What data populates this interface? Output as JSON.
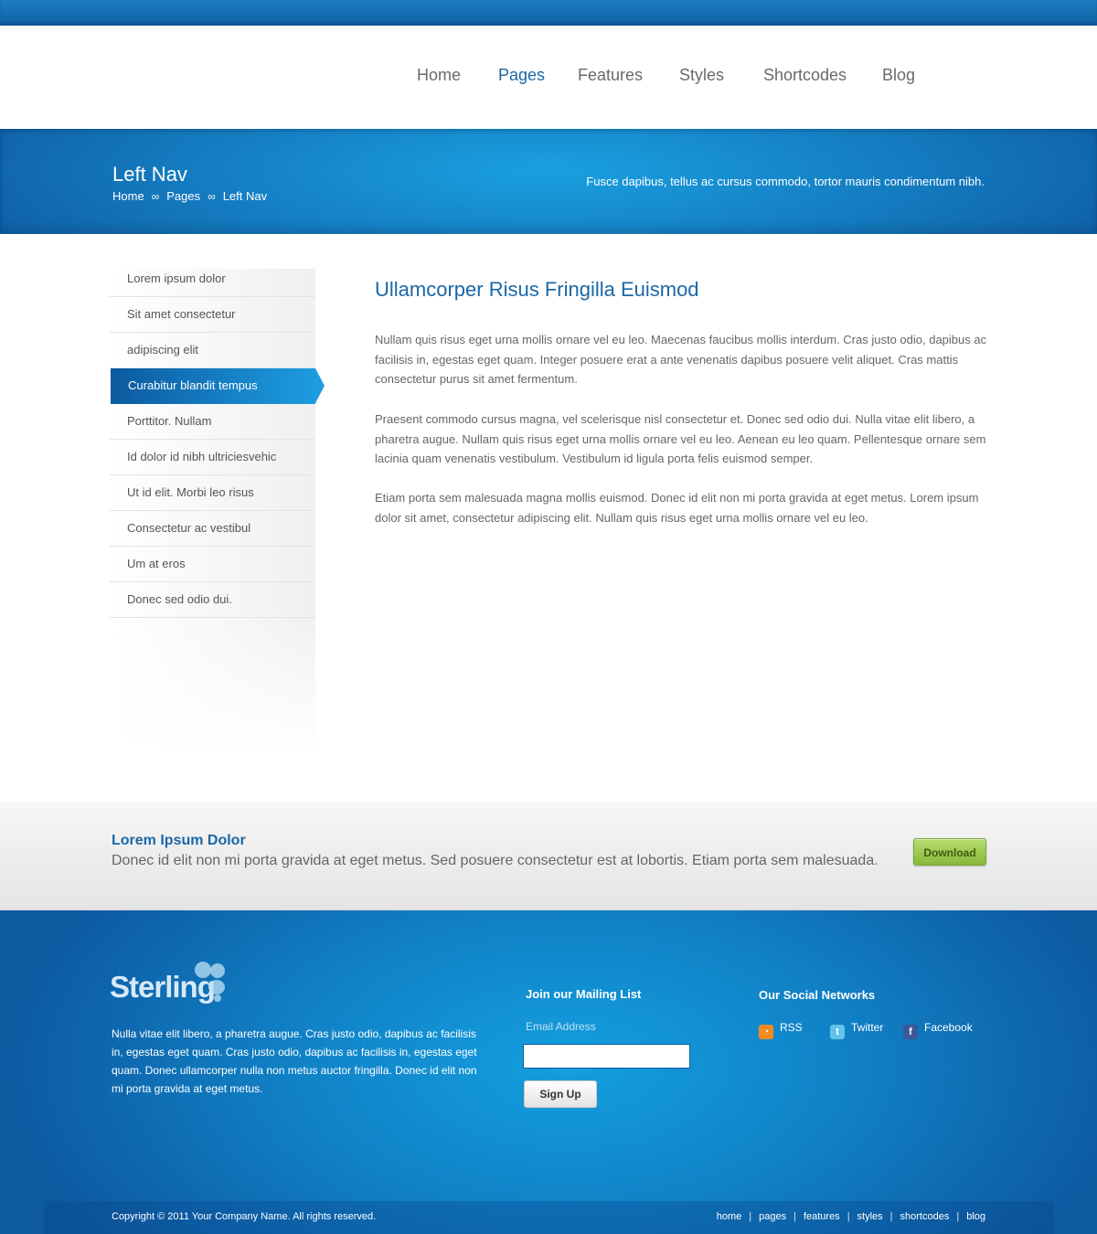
{
  "nav": {
    "items": [
      {
        "label": "Home"
      },
      {
        "label": "Pages"
      },
      {
        "label": "Features"
      },
      {
        "label": "Styles"
      },
      {
        "label": "Shortcodes"
      },
      {
        "label": "Blog"
      }
    ],
    "active": "Pages"
  },
  "banner": {
    "title": "Left Nav",
    "breadcrumb": [
      "Home",
      "Pages",
      "Left Nav"
    ],
    "separator": "∞",
    "tagline": "Fusce dapibus, tellus ac cursus commodo, tortor mauris condimentum nibh."
  },
  "sidebar": {
    "items": [
      {
        "label": "Lorem ipsum dolor"
      },
      {
        "label": "Sit amet consectetur"
      },
      {
        "label": "adipiscing elit"
      },
      {
        "label": "Curabitur blandit tempus"
      },
      {
        "label": "Porttitor. Nullam"
      },
      {
        "label": "Id dolor id nibh ultriciesvehic"
      },
      {
        "label": "Ut id elit. Morbi leo risus"
      },
      {
        "label": "Consectetur ac vestibul"
      },
      {
        "label": "Um at eros"
      },
      {
        "label": "Donec sed odio dui."
      }
    ],
    "active": "Curabitur blandit tempus"
  },
  "main": {
    "heading": "Ullamcorper Risus Fringilla Euismod",
    "paragraphs": [
      "Nullam quis risus eget urna mollis ornare vel eu leo. Maecenas faucibus mollis interdum. Cras justo odio, dapibus ac facilisis in, egestas eget quam. Integer posuere erat a ante venenatis dapibus posuere velit aliquet. Cras mattis consectetur purus sit amet fermentum.",
      "Praesent commodo cursus magna, vel scelerisque nisl consectetur et. Donec sed odio dui. Nulla vitae elit libero, a pharetra augue. Nullam quis risus eget urna mollis ornare vel eu leo. Aenean eu leo quam. Pellentesque ornare sem lacinia quam venenatis vestibulum. Vestibulum id ligula porta felis euismod semper.",
      "Etiam porta sem malesuada magna mollis euismod. Donec id elit non mi porta gravida at eget metus. Lorem ipsum dolor sit amet, consectetur adipiscing elit. Nullam quis risus eget urna mollis ornare vel eu leo."
    ]
  },
  "cta": {
    "heading": "Lorem Ipsum Dolor",
    "text": "Donec id elit non mi porta gravida at eget metus. Sed posuere consectetur est at lobortis. Etiam porta sem malesuada.",
    "button_label": "Download"
  },
  "footer": {
    "logo_text": "Sterling",
    "about": "Nulla vitae elit libero, a pharetra augue. Cras justo odio, dapibus ac facilisis in, egestas eget quam. Cras justo odio, dapibus ac facilisis in, egestas eget quam. Donec ullamcorper nulla non metus auctor fringilla. Donec id elit non mi porta gravida at eget metus.",
    "mailing_heading": "Join our Mailing List",
    "email_label": "Email Address",
    "email_value": "",
    "signup_label": "Sign Up",
    "social_heading": "Our Social Networks",
    "social": [
      {
        "label": "RSS",
        "icon": "rss-icon"
      },
      {
        "label": "Twitter",
        "icon": "twitter-icon"
      },
      {
        "label": "Facebook",
        "icon": "facebook-icon"
      }
    ],
    "copyright": "Copyright © 2011 Your Company Name. All rights reserved.",
    "links": [
      "home",
      "pages",
      "features",
      "styles",
      "shortcodes",
      "blog"
    ]
  },
  "colors": {
    "accent": "#1b67a6",
    "banner": "#1686c9",
    "download": "#9ccc50"
  }
}
